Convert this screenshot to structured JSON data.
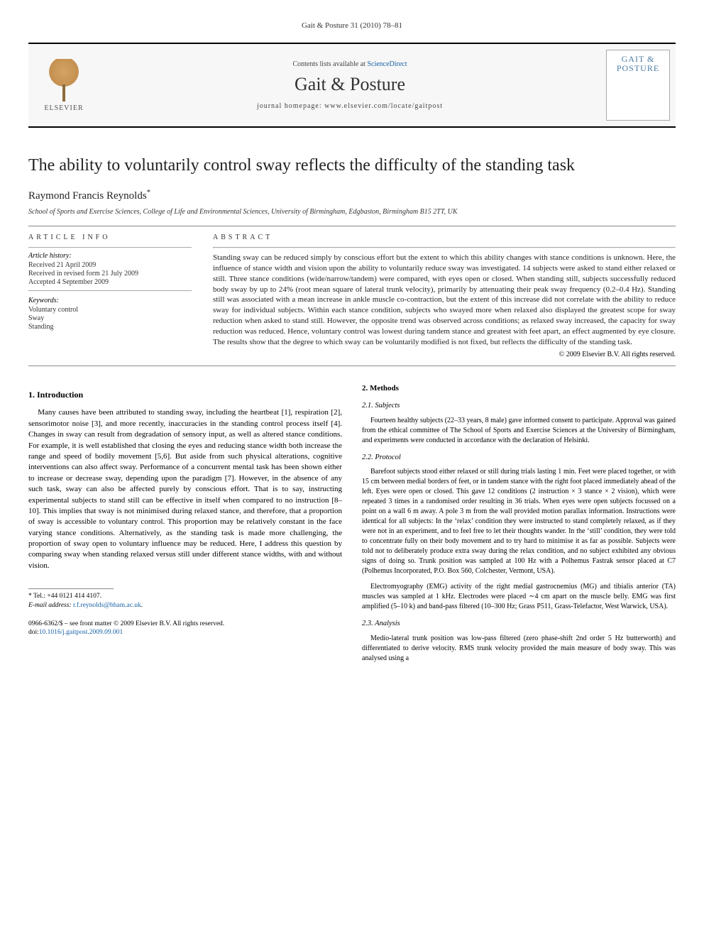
{
  "running_head": "Gait & Posture 31 (2010) 78–81",
  "header": {
    "publisher": "ELSEVIER",
    "contents_prefix": "Contents lists available at ",
    "contents_link": "ScienceDirect",
    "journal": "Gait & Posture",
    "homepage_label": "journal homepage: www.elsevier.com/locate/gaitpost",
    "cover_line1": "GAIT &",
    "cover_line2": "POSTURE"
  },
  "title": "The ability to voluntarily control sway reflects the difficulty of the standing task",
  "author": "Raymond Francis Reynolds",
  "author_marker": "*",
  "affiliation": "School of Sports and Exercise Sciences, College of Life and Environmental Sciences, University of Birmingham, Edgbaston, Birmingham B15 2TT, UK",
  "info": {
    "heading": "ARTICLE INFO",
    "history_label": "Article history:",
    "received": "Received 21 April 2009",
    "revised": "Received in revised form 21 July 2009",
    "accepted": "Accepted 4 September 2009",
    "keywords_label": "Keywords:",
    "keywords": [
      "Voluntary control",
      "Sway",
      "Standing"
    ]
  },
  "abstract": {
    "heading": "ABSTRACT",
    "text": "Standing sway can be reduced simply by conscious effort but the extent to which this ability changes with stance conditions is unknown. Here, the influence of stance width and vision upon the ability to voluntarily reduce sway was investigated. 14 subjects were asked to stand either relaxed or still. Three stance conditions (wide/narrow/tandem) were compared, with eyes open or closed. When standing still, subjects successfully reduced body sway by up to 24% (root mean square of lateral trunk velocity), primarily by attenuating their peak sway frequency (0.2–0.4 Hz). Standing still was associated with a mean increase in ankle muscle co-contraction, but the extent of this increase did not correlate with the ability to reduce sway for individual subjects. Within each stance condition, subjects who swayed more when relaxed also displayed the greatest scope for sway reduction when asked to stand still. However, the opposite trend was observed across conditions; as relaxed sway increased, the capacity for sway reduction was reduced. Hence, voluntary control was lowest during tandem stance and greatest with feet apart, an effect augmented by eye closure. The results show that the degree to which sway can be voluntarily modified is not fixed, but reflects the difficulty of the standing task.",
    "copyright": "© 2009 Elsevier B.V. All rights reserved."
  },
  "sections": {
    "intro_head": "1. Introduction",
    "intro_p1": "Many causes have been attributed to standing sway, including the heartbeat [1], respiration [2], sensorimotor noise [3], and more recently, inaccuracies in the standing control process itself [4]. Changes in sway can result from degradation of sensory input, as well as altered stance conditions. For example, it is well established that closing the eyes and reducing stance width both increase the range and speed of bodily movement [5,6]. But aside from such physical alterations, cognitive interventions can also affect sway. Performance of a concurrent mental task has been shown either to increase or decrease sway, depending upon the paradigm [7]. However, in the absence of any such task, sway can also be affected purely by conscious effort. That is to say, instructing experimental subjects to stand still can be effective in itself when compared to no instruction [8–10]. This implies that sway is not minimised during relaxed stance, and therefore, that a proportion of sway is accessible to voluntary control. This proportion may be relatively constant in the face varying stance conditions. Alternatively, as the standing task is made more challenging, the proportion of sway open to voluntary influence may be reduced. Here, I address this question by comparing sway when standing relaxed versus still under different stance widths, with and without vision.",
    "methods_head": "2. Methods",
    "subjects_head": "2.1. Subjects",
    "subjects_p": "Fourteen healthy subjects (22–33 years, 8 male) gave informed consent to participate. Approval was gained from the ethical committee of The School of Sports and Exercise Sciences at the University of Birmingham, and experiments were conducted in accordance with the declaration of Helsinki.",
    "protocol_head": "2.2. Protocol",
    "protocol_p1": "Barefoot subjects stood either relaxed or still during trials lasting 1 min. Feet were placed together, or with 15 cm between medial borders of feet, or in tandem stance with the right foot placed immediately ahead of the left. Eyes were open or closed. This gave 12 conditions (2 instruction × 3 stance × 2 vision), which were repeated 3 times in a randomised order resulting in 36 trials. When eyes were open subjects focussed on a point on a wall 6 m away. A pole 3 m from the wall provided motion parallax information. Instructions were identical for all subjects: In the ‘relax’ condition they were instructed to stand completely relaxed, as if they were not in an experiment, and to feel free to let their thoughts wander. In the ‘still’ condition, they were told to concentrate fully on their body movement and to try hard to minimise it as far as possible. Subjects were told not to deliberately produce extra sway during the relax condition, and no subject exhibited any obvious signs of doing so. Trunk position was sampled at 100 Hz with a Polhemus Fastrak sensor placed at C7 (Polhemus Incorporated, P.O. Box 560, Colchester, Vermont, USA).",
    "protocol_p2": "Electromyography (EMG) activity of the right medial gastrocnemius (MG) and tibialis anterior (TA) muscles was sampled at 1 kHz. Electrodes were placed ∼4 cm apart on the muscle belly. EMG was first amplified (5–10 k) and band-pass filtered (10–300 Hz; Grass P511, Grass-Telefactor, West Warwick, USA).",
    "analysis_head": "2.3. Analysis",
    "analysis_p": "Medio-lateral trunk position was low-pass filtered (zero phase-shift 2nd order 5 Hz butterworth) and differentiated to derive velocity. RMS trunk velocity provided the main measure of body sway. This was analysed using a"
  },
  "footnote": {
    "tel_label": "* Tel.: ",
    "tel": "+44 0121 414 4107.",
    "email_label": "E-mail address: ",
    "email": "r.f.reynolds@bham.ac.uk",
    "email_suffix": "."
  },
  "bottom": {
    "front_matter": "0966-6362/$ – see front matter © 2009 Elsevier B.V. All rights reserved.",
    "doi_label": "doi:",
    "doi": "10.1016/j.gaitpost.2009.09.001"
  }
}
